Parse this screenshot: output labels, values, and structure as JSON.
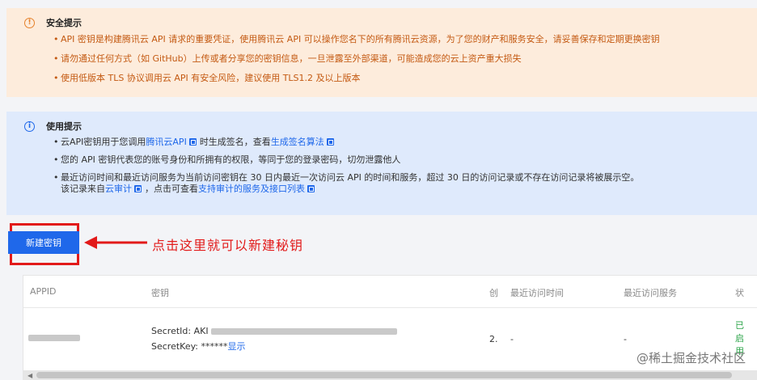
{
  "security_notice": {
    "icon": "exclamation-circle-icon",
    "title": "安全提示",
    "items": [
      "API 密钥是构建腾讯云 API 请求的重要凭证，使用腾讯云 API 可以操作您名下的所有腾讯云资源，为了您的财产和服务安全，请妥善保存和定期更换密钥",
      "请勿通过任何方式（如 GitHub）上传或者分享您的密钥信息，一旦泄露至外部渠道，可能造成您的云上资产重大损失",
      "使用低版本 TLS 协议调用云 API 有安全风险，建议使用 TLS1.2 及以上版本"
    ]
  },
  "usage_notice": {
    "icon": "info-circle-icon",
    "title": "使用提示",
    "item1": {
      "pre": "云API密钥用于您调用",
      "link1": "腾讯云API",
      "mid": "时生成签名，查看",
      "link2": "生成签名算法"
    },
    "item2": "您的 API 密钥代表您的账号身份和所拥有的权限，等同于您的登录密码，切勿泄露他人",
    "item3": {
      "line1": "最近访问时间和最近访问服务为当前访问密钥在 30 日内最近一次访问云 API 的时间和服务，超过 30 日的访问记录或不存在访问记录将被展示空。",
      "pre": "该记录来自",
      "link1": "云审计",
      "mid": "，点击可查看",
      "link2": "支持审计的服务及接口列表"
    }
  },
  "new_key_button": "新建密钥",
  "annotation": "点击这里就可以新建秘钥",
  "table": {
    "headers": [
      "APPID",
      "密钥",
      "创",
      "最近访问时间",
      "最近访问服务",
      "状"
    ],
    "row": {
      "secret_id_label": "SecretId: AKI",
      "secret_key_label": "SecretKey: ******",
      "show_link": "显示",
      "created": "2.",
      "last_access_time": "-",
      "last_access_service": "-",
      "status": "已启用"
    }
  },
  "watermark": "@稀土掘金技术社区",
  "colors": {
    "accent": "#1f68ea",
    "warn": "#e6812b",
    "annotation_red": "#e21a1a"
  }
}
